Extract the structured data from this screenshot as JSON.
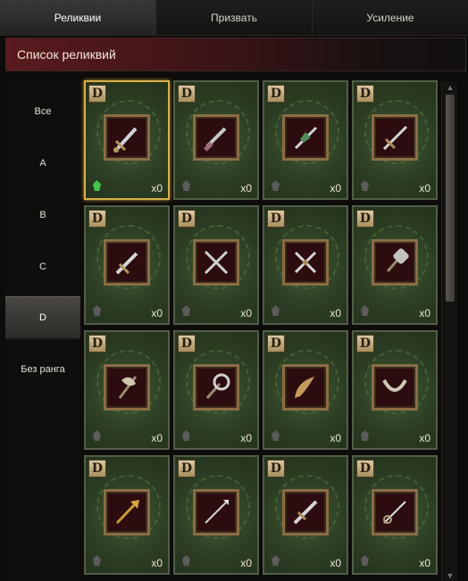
{
  "tabs": [
    {
      "label": "Реликвии",
      "active": true
    },
    {
      "label": "Призвать",
      "active": false
    },
    {
      "label": "Усиление",
      "active": false
    }
  ],
  "header": {
    "title": "Список реликвий"
  },
  "filters": [
    {
      "label": "Все",
      "active": false
    },
    {
      "label": "A",
      "active": false
    },
    {
      "label": "B",
      "active": false
    },
    {
      "label": "C",
      "active": false
    },
    {
      "label": "D",
      "active": true
    },
    {
      "label": "Без ранга",
      "active": false
    }
  ],
  "relics": [
    {
      "rank": "D",
      "count": "x0",
      "icon": "short-sword-icon",
      "owned": true,
      "selected": true
    },
    {
      "rank": "D",
      "count": "x0",
      "icon": "dagger-icon",
      "owned": false
    },
    {
      "rank": "D",
      "count": "x0",
      "icon": "ornate-sword-icon",
      "owned": false
    },
    {
      "rank": "D",
      "count": "x0",
      "icon": "long-sword-icon",
      "owned": false
    },
    {
      "rank": "D",
      "count": "x0",
      "icon": "broadsword-icon",
      "owned": false
    },
    {
      "rank": "D",
      "count": "x0",
      "icon": "crossed-swords-icon",
      "owned": false
    },
    {
      "rank": "D",
      "count": "x0",
      "icon": "crossed-blades-icon",
      "owned": false
    },
    {
      "rank": "D",
      "count": "x0",
      "icon": "warhammer-icon",
      "owned": false
    },
    {
      "rank": "D",
      "count": "x0",
      "icon": "battle-axe-icon",
      "owned": false
    },
    {
      "rank": "D",
      "count": "x0",
      "icon": "mace-icon",
      "owned": false
    },
    {
      "rank": "D",
      "count": "x0",
      "icon": "horn-blade-icon",
      "owned": false
    },
    {
      "rank": "D",
      "count": "x0",
      "icon": "curved-blade-icon",
      "owned": false
    },
    {
      "rank": "D",
      "count": "x0",
      "icon": "trident-icon",
      "owned": false
    },
    {
      "rank": "D",
      "count": "x0",
      "icon": "spear-icon",
      "owned": false
    },
    {
      "rank": "D",
      "count": "x0",
      "icon": "greatsword-icon",
      "owned": false
    },
    {
      "rank": "D",
      "count": "x0",
      "icon": "rapier-icon",
      "owned": false
    }
  ],
  "colors": {
    "card": "#2d3b23",
    "selected_border": "#d6b14a",
    "gem_owned": "#46c24a",
    "header_red": "#5a1a1e"
  }
}
